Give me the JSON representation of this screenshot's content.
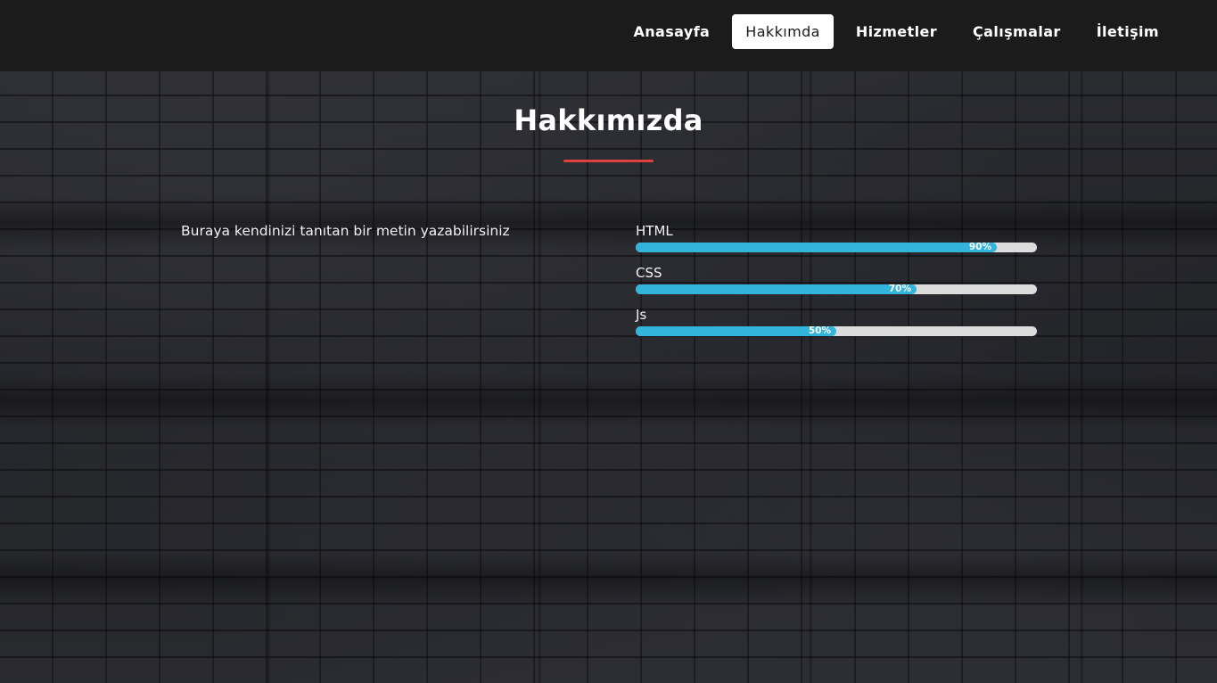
{
  "nav": {
    "items": [
      {
        "label": "Anasayfa",
        "active": false
      },
      {
        "label": "Hakkımda",
        "active": true
      },
      {
        "label": "Hizmetler",
        "active": false
      },
      {
        "label": "Çalışmalar",
        "active": false
      },
      {
        "label": "İletişim",
        "active": false
      }
    ]
  },
  "about": {
    "title": "Hakkımızda",
    "text": "Buraya kendinizi tanıtan bir metin yazabilirsiniz",
    "accent_color": "#e0413e"
  },
  "skills": {
    "bar_color": "#33b5db",
    "track_color": "#dcdcdc",
    "items": [
      {
        "name": "HTML",
        "percent": 90,
        "label": "90%"
      },
      {
        "name": "CSS",
        "percent": 70,
        "label": "70%"
      },
      {
        "name": "Js",
        "percent": 50,
        "label": "50%"
      }
    ]
  }
}
